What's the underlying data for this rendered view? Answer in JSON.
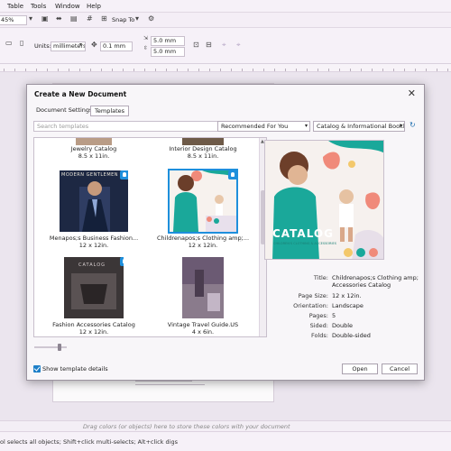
{
  "menu": {
    "items": [
      "Table",
      "Tools",
      "Window",
      "Help"
    ]
  },
  "toolbar": {
    "zoom": "45%",
    "snap_to": "Snap To",
    "units_label": "Units:",
    "units_value": "millimeters",
    "nudge": "0.1 mm",
    "dup_x": "5.0 mm",
    "dup_y": "5.0 mm"
  },
  "dialog": {
    "title": "Create a New Document",
    "tabs": [
      "Document Settings",
      "Templates"
    ],
    "search_placeholder": "Search templates",
    "sort_filter": "Recommended For You",
    "category_filter": "Catalog & Informational Booklets",
    "templates": [
      {
        "name": "Jewelry Catalog",
        "size": "8.5 x 11in.",
        "badge": false
      },
      {
        "name": "Interior Design Catalog",
        "size": "8.5 x 11in.",
        "badge": false
      },
      {
        "name": "Menapos;s Business Fashion...",
        "size": "12 x 12in.",
        "badge": true,
        "cover_text": "MODERN GENTLEMEN"
      },
      {
        "name": "Childrenapos;s Clothing amp;...",
        "size": "12 x 12in.",
        "badge": true,
        "selected": true
      },
      {
        "name": "Fashion Accessories Catalog",
        "size": "12 x 12in.",
        "badge": true,
        "cover_text": "CATALOG"
      },
      {
        "name": "Vintage Travel Guide.US",
        "size": "4 x 6in.",
        "badge": true
      }
    ],
    "preview": {
      "cover_title": "CATALOG",
      "cover_sub": "CHILDREN'S CLOTHING & ACCESSORIES"
    },
    "details": [
      {
        "label": "Title:",
        "value": "Childrenapos;s Clothing amp; Accessories Catalog"
      },
      {
        "label": "Page Size:",
        "value": "12 x 12in."
      },
      {
        "label": "Orientation:",
        "value": "Landscape"
      },
      {
        "label": "Pages:",
        "value": "5"
      },
      {
        "label": "Sided:",
        "value": "Double"
      },
      {
        "label": "Folds:",
        "value": "Double-sided"
      }
    ],
    "show_details_label": "Show template details",
    "open_label": "Open",
    "cancel_label": "Cancel"
  },
  "status": {
    "color_hint": "Drag colors (or objects) here to store these colors with your document",
    "bottom_hint": "ol selects all objects; Shift+click multi-selects; Alt+click digs"
  },
  "colors": {
    "accent": "#1e8fdc",
    "teal": "#1aa89a",
    "coral": "#f08a7a"
  }
}
